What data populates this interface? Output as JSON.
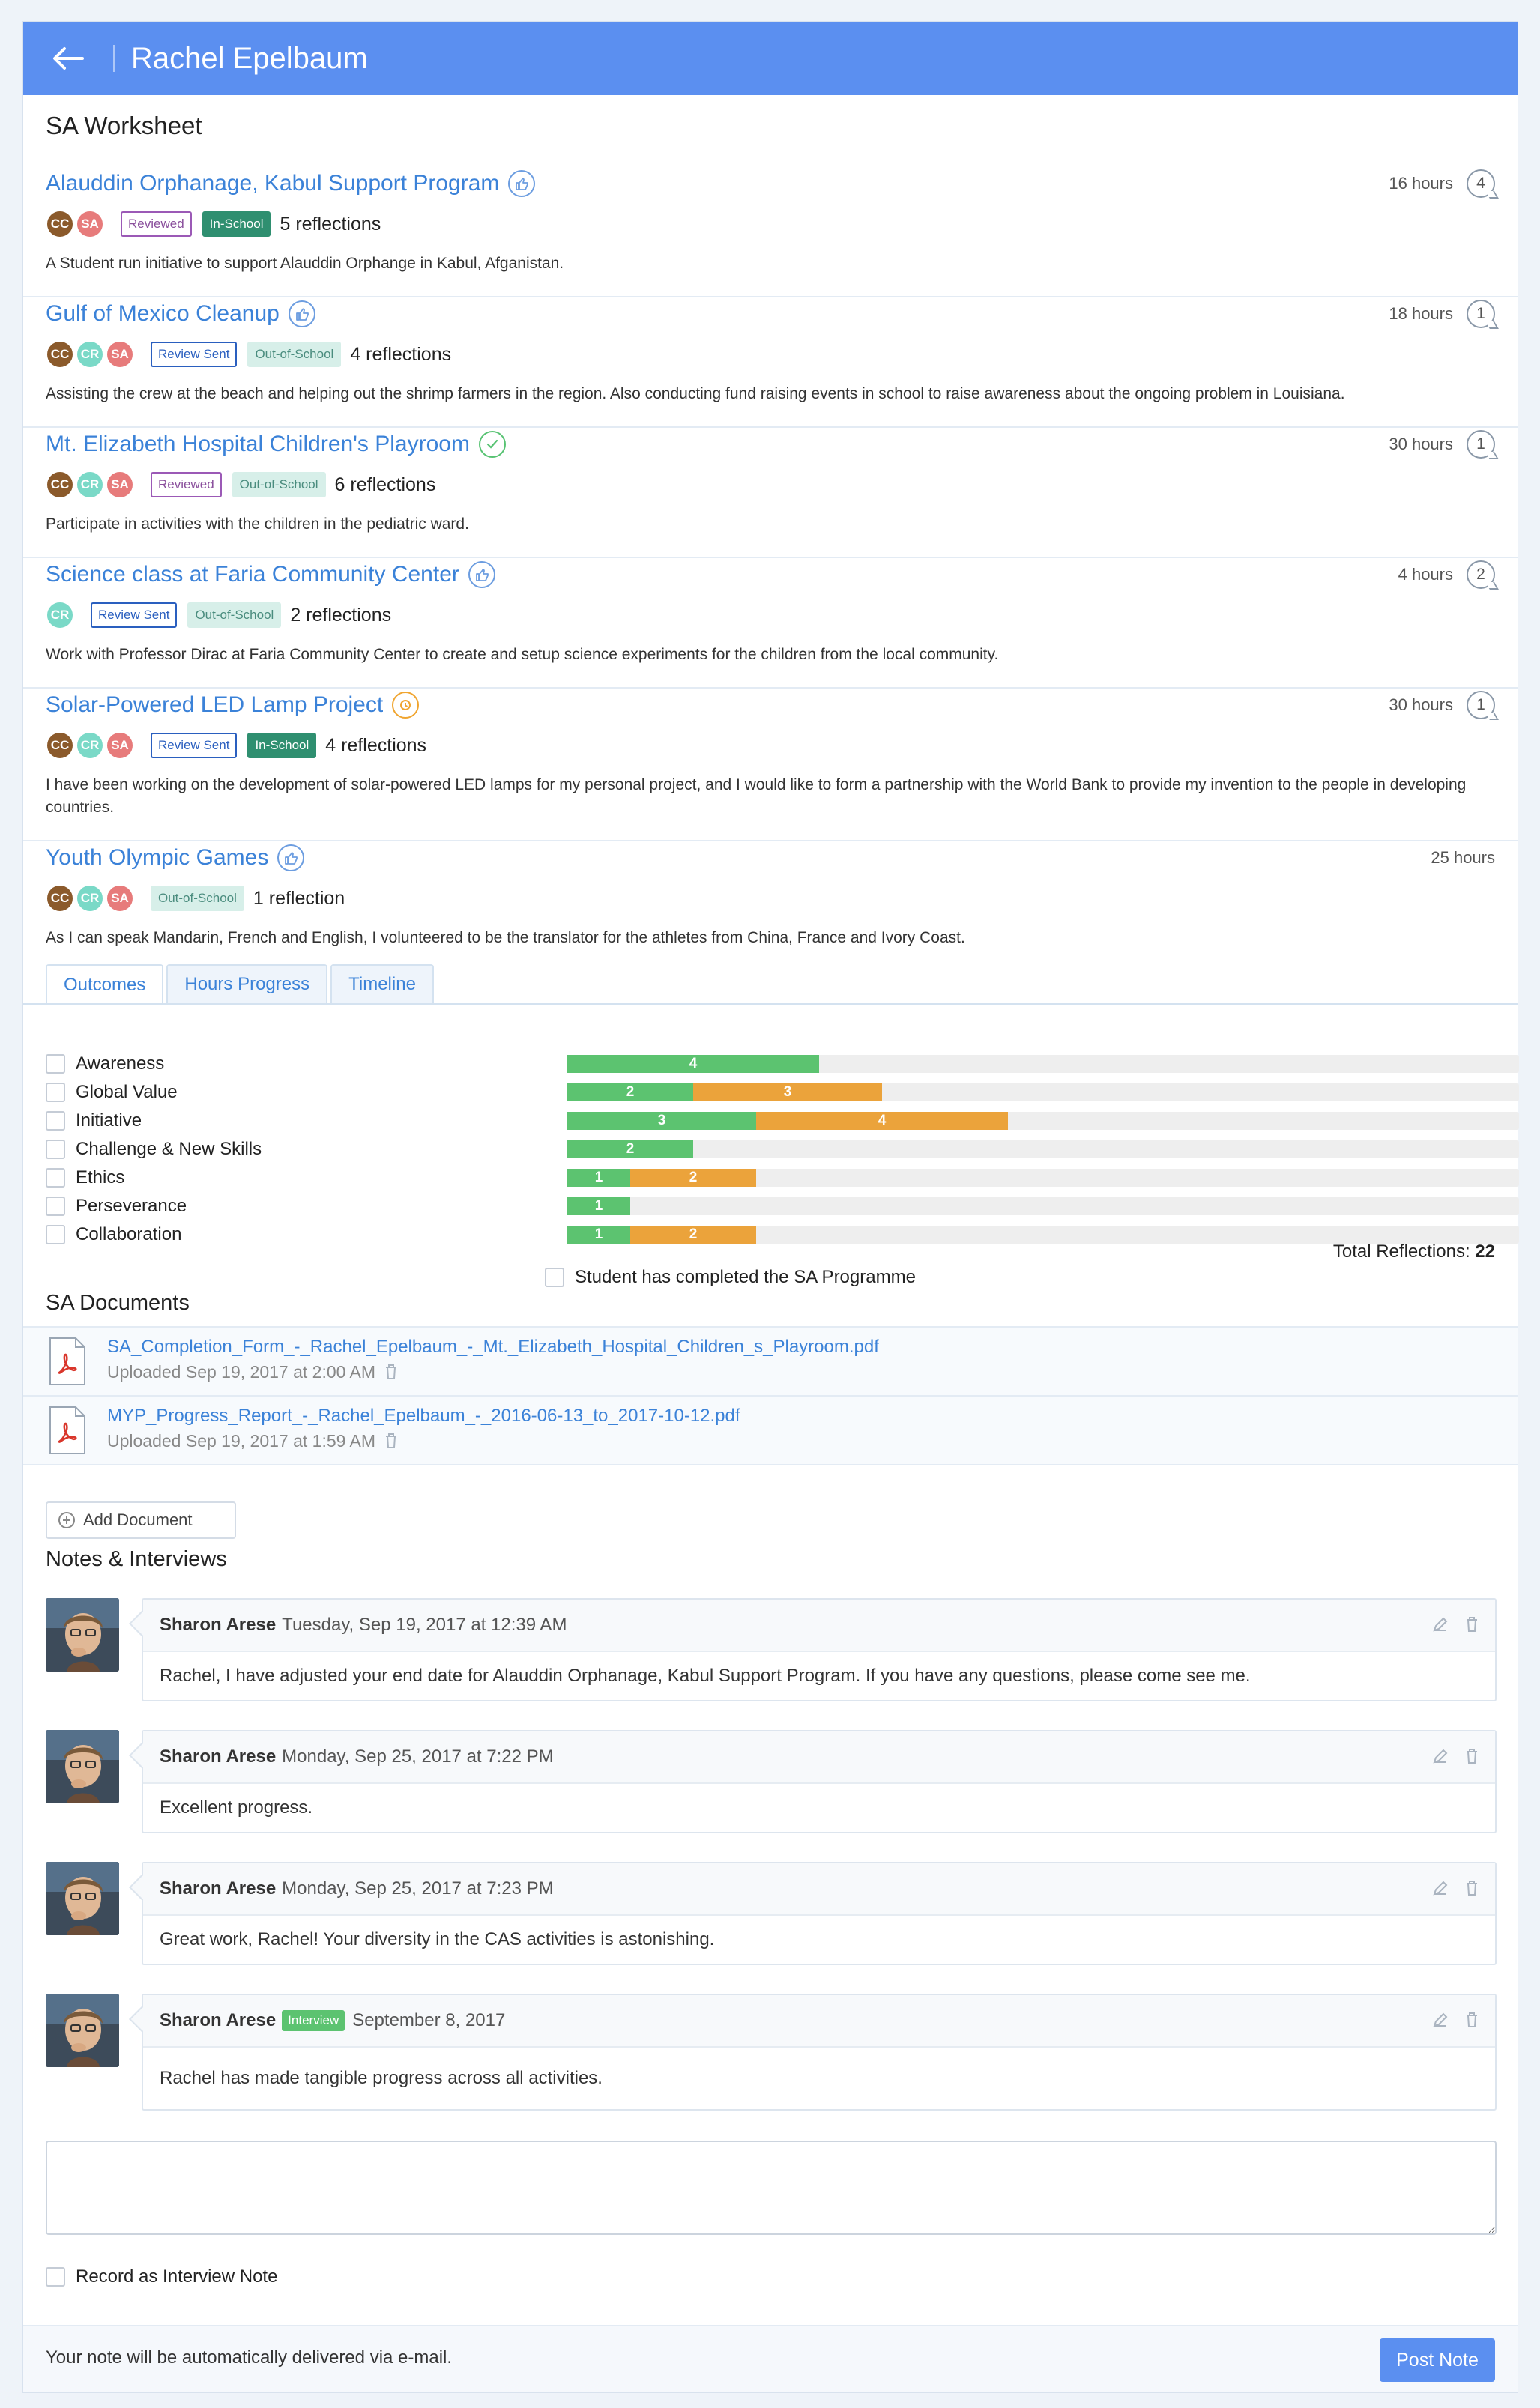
{
  "header": {
    "title": "Rachel Epelbaum"
  },
  "worksheet": {
    "title": "SA Worksheet",
    "activities": [
      {
        "title": "Alauddin Orphanage, Kabul Support Program",
        "status_icon": "thumbs-up-icon",
        "hours": "16 hours",
        "comments": "4",
        "avatars": [
          "CC",
          "SA"
        ],
        "tags": [
          {
            "label": "Reviewed",
            "kind": "reviewed"
          },
          {
            "label": "In-School",
            "kind": "in"
          }
        ],
        "reflections": "5 reflections",
        "description": "A Student run initiative to support Alauddin Orphange in Kabul, Afganistan."
      },
      {
        "title": "Gulf of Mexico Cleanup",
        "status_icon": "thumbs-up-icon",
        "hours": "18 hours",
        "comments": "1",
        "avatars": [
          "CC",
          "CR",
          "SA"
        ],
        "tags": [
          {
            "label": "Review Sent",
            "kind": "sent"
          },
          {
            "label": "Out-of-School",
            "kind": "out"
          }
        ],
        "reflections": "4 reflections",
        "description": "Assisting the crew at the beach and helping out the shrimp farmers in the region. Also conducting fund raising events in school to raise awareness about the ongoing problem in Louisiana."
      },
      {
        "title": "Mt. Elizabeth Hospital Children's Playroom",
        "status_icon": "check-circle-icon",
        "hours": "30 hours",
        "comments": "1",
        "avatars": [
          "CC",
          "CR",
          "SA"
        ],
        "tags": [
          {
            "label": "Reviewed",
            "kind": "reviewed"
          },
          {
            "label": "Out-of-School",
            "kind": "out"
          }
        ],
        "reflections": "6 reflections",
        "description": "Participate in activities with the children in the pediatric ward."
      },
      {
        "title": "Science class at Faria Community Center",
        "status_icon": "thumbs-up-icon",
        "hours": "4 hours",
        "comments": "2",
        "avatars": [
          "CR"
        ],
        "tags": [
          {
            "label": "Review Sent",
            "kind": "sent"
          },
          {
            "label": "Out-of-School",
            "kind": "out"
          }
        ],
        "reflections": "2 reflections",
        "description": "Work with Professor Dirac at Faria Community Center to create and setup science experiments for the children from the local community."
      },
      {
        "title": "Solar-Powered LED Lamp Project",
        "status_icon": "clock-icon",
        "hours": "30 hours",
        "comments": "1",
        "avatars": [
          "CC",
          "CR",
          "SA"
        ],
        "tags": [
          {
            "label": "Review Sent",
            "kind": "sent"
          },
          {
            "label": "In-School",
            "kind": "in"
          }
        ],
        "reflections": "4 reflections",
        "description": "I have been working on the development of solar-powered LED lamps for my personal project, and I would like to form a partnership with the World Bank to provide my invention to the people in developing countries."
      },
      {
        "title": "Youth Olympic Games",
        "status_icon": "thumbs-up-icon",
        "hours": "25 hours",
        "comments": "",
        "avatars": [
          "CC",
          "CR",
          "SA"
        ],
        "tags": [
          {
            "label": "Out-of-School",
            "kind": "out"
          }
        ],
        "reflections": "1 reflection",
        "description": "As I can speak Mandarin, French and English, I volunteered to be the translator for the athletes from China, France and Ivory Coast."
      }
    ]
  },
  "tabs": [
    "Outcomes",
    "Hours Progress",
    "Timeline"
  ],
  "outcomes": [
    {
      "label": "Awareness",
      "segments": [
        {
          "value": 4,
          "color": "#5cc370"
        }
      ]
    },
    {
      "label": "Global Value",
      "segments": [
        {
          "value": 2,
          "color": "#5cc370"
        },
        {
          "value": 3,
          "color": "#eba33b"
        }
      ]
    },
    {
      "label": "Initiative",
      "segments": [
        {
          "value": 3,
          "color": "#5cc370"
        },
        {
          "value": 4,
          "color": "#eba33b"
        }
      ]
    },
    {
      "label": "Challenge & New Skills",
      "segments": [
        {
          "value": 2,
          "color": "#5cc370"
        }
      ]
    },
    {
      "label": "Ethics",
      "segments": [
        {
          "value": 1,
          "color": "#5cc370"
        },
        {
          "value": 2,
          "color": "#eba33b"
        }
      ]
    },
    {
      "label": "Perseverance",
      "segments": [
        {
          "value": 1,
          "color": "#5cc370"
        }
      ]
    },
    {
      "label": "Collaboration",
      "segments": [
        {
          "value": 1,
          "color": "#5cc370"
        },
        {
          "value": 2,
          "color": "#eba33b"
        }
      ]
    }
  ],
  "total_reflections": {
    "label": "Total Reflections:",
    "value": "22"
  },
  "completed_label": "Student has completed the SA Programme",
  "documents": {
    "title": "SA Documents",
    "items": [
      {
        "name": "SA_Completion_Form_-_Rachel_Epelbaum_-_Mt._Elizabeth_Hospital_Children_s_Playroom.pdf",
        "uploaded": "Uploaded Sep 19, 2017 at 2:00 AM"
      },
      {
        "name": "MYP_Progress_Report_-_Rachel_Epelbaum_-_2016-06-13_to_2017-10-12.pdf",
        "uploaded": "Uploaded Sep 19, 2017 at 1:59 AM"
      }
    ],
    "add_label": "Add Document"
  },
  "notes": {
    "title": "Notes & Interviews",
    "items": [
      {
        "author": "Sharon Arese",
        "tag": "",
        "date": "Tuesday, Sep 19, 2017 at 12:39 AM",
        "text": "Rachel, I have adjusted your end date for Alauddin Orphanage, Kabul Support Program. If you have any questions, please come see me."
      },
      {
        "author": "Sharon Arese",
        "tag": "",
        "date": "Monday, Sep 25, 2017 at 7:22 PM",
        "text": "Excellent progress."
      },
      {
        "author": "Sharon Arese",
        "tag": "",
        "date": "Monday, Sep 25, 2017 at 7:23 PM",
        "text": "Great work, Rachel! Your diversity in the CAS activities is astonishing."
      },
      {
        "author": "Sharon Arese",
        "tag": "Interview",
        "date": "September 8, 2017",
        "text": "Rachel has made tangible progress across all activities."
      }
    ],
    "interview_label": "Record as Interview Note",
    "footer_msg": "Your note will be automatically delivered via e-mail.",
    "post_label": "Post Note"
  }
}
